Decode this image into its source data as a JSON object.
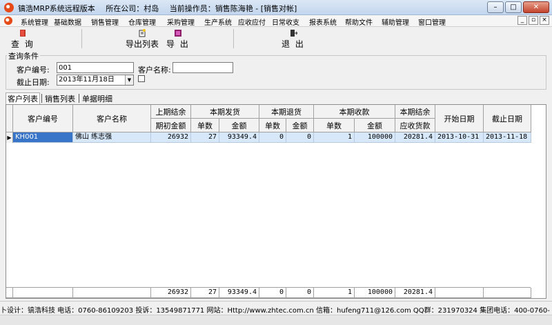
{
  "window": {
    "app_name": "镐浩MRP系统远程版本",
    "location": "所在公司：村岛",
    "operator": "当前操作员：销售陈海艳 - [销售对帐]"
  },
  "menu": [
    "系统管理",
    "基础数据",
    "销售管理",
    "仓库管理",
    "采购管理",
    "生产系统",
    "应收应付",
    "日常收支",
    "报表系统",
    "帮助文件",
    "辅助管理",
    "窗口管理"
  ],
  "toolbar": {
    "query": "查 询",
    "export_list": "导出列表",
    "export": "导 出",
    "exit": "退 出"
  },
  "query": {
    "title": "查询条件",
    "customer_code_label": "客户编号:",
    "customer_code_value": "001",
    "customer_name_label": "客户名称:",
    "customer_name_value": "",
    "end_date_label": "截止日期:",
    "end_date_value": "2013年11月18日"
  },
  "tabs": [
    "客户列表",
    "销售列表",
    "单据明细"
  ],
  "grid": {
    "headers": {
      "customer_code": "客户编号",
      "customer_name": "客户名称",
      "prev_balance": "上期结余",
      "opening_amount": "期初金额",
      "shipments": "本期发货",
      "returns": "本期退货",
      "receipts": "本期收款",
      "qty": "单数",
      "amount": "金额",
      "current_balance": "本期结余",
      "receivable": "应收货款",
      "start_date": "开始日期",
      "end_date": "截止日期"
    },
    "row": {
      "code": "KH001",
      "name": "佛山 练志强",
      "opening": "26932",
      "ship_qty": "27",
      "ship_amt": "93349.4",
      "ret_qty": "0",
      "ret_amt": "0",
      "rec_qty": "1",
      "rec_amt": "100000",
      "receivable": "20281.4",
      "start": "2013-10-31",
      "end": "2013-11-18"
    },
    "totals": {
      "opening": "26932",
      "ship_qty": "27",
      "ship_amt": "93349.4",
      "ret_qty": "0",
      "ret_amt": "0",
      "rec_qty": "1",
      "rec_amt": "100000",
      "receivable": "20281.4"
    }
  },
  "status": "卜设计：镐浩科技 电话：0760-86109203  投诉：13549871771 网站：Http://www.zhtec.com.cn 信箱：hufeng711@126.com QQ群：231970324 集团电话：400-0760-"
}
